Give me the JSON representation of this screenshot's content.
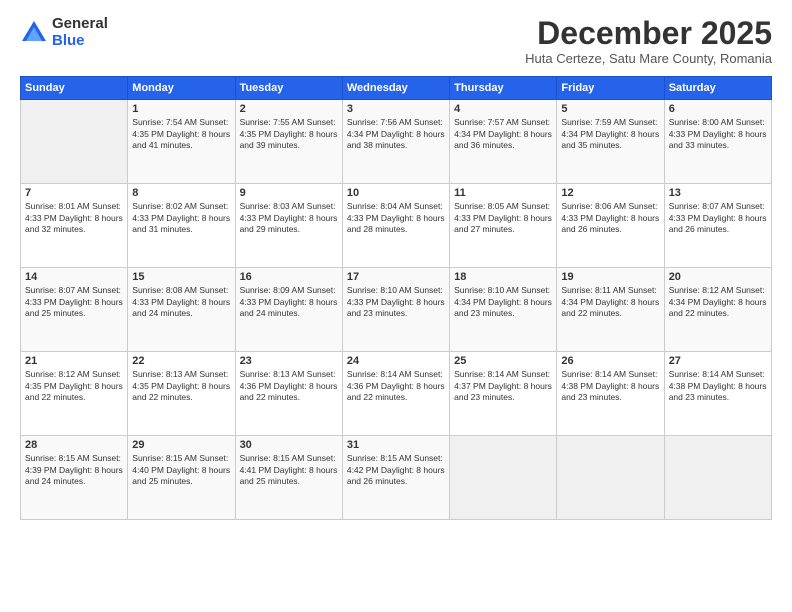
{
  "logo": {
    "general": "General",
    "blue": "Blue"
  },
  "title": "December 2025",
  "location": "Huta Certeze, Satu Mare County, Romania",
  "days_header": [
    "Sunday",
    "Monday",
    "Tuesday",
    "Wednesday",
    "Thursday",
    "Friday",
    "Saturday"
  ],
  "weeks": [
    [
      {
        "day": "",
        "content": ""
      },
      {
        "day": "1",
        "content": "Sunrise: 7:54 AM\nSunset: 4:35 PM\nDaylight: 8 hours\nand 41 minutes."
      },
      {
        "day": "2",
        "content": "Sunrise: 7:55 AM\nSunset: 4:35 PM\nDaylight: 8 hours\nand 39 minutes."
      },
      {
        "day": "3",
        "content": "Sunrise: 7:56 AM\nSunset: 4:34 PM\nDaylight: 8 hours\nand 38 minutes."
      },
      {
        "day": "4",
        "content": "Sunrise: 7:57 AM\nSunset: 4:34 PM\nDaylight: 8 hours\nand 36 minutes."
      },
      {
        "day": "5",
        "content": "Sunrise: 7:59 AM\nSunset: 4:34 PM\nDaylight: 8 hours\nand 35 minutes."
      },
      {
        "day": "6",
        "content": "Sunrise: 8:00 AM\nSunset: 4:33 PM\nDaylight: 8 hours\nand 33 minutes."
      }
    ],
    [
      {
        "day": "7",
        "content": "Sunrise: 8:01 AM\nSunset: 4:33 PM\nDaylight: 8 hours\nand 32 minutes."
      },
      {
        "day": "8",
        "content": "Sunrise: 8:02 AM\nSunset: 4:33 PM\nDaylight: 8 hours\nand 31 minutes."
      },
      {
        "day": "9",
        "content": "Sunrise: 8:03 AM\nSunset: 4:33 PM\nDaylight: 8 hours\nand 29 minutes."
      },
      {
        "day": "10",
        "content": "Sunrise: 8:04 AM\nSunset: 4:33 PM\nDaylight: 8 hours\nand 28 minutes."
      },
      {
        "day": "11",
        "content": "Sunrise: 8:05 AM\nSunset: 4:33 PM\nDaylight: 8 hours\nand 27 minutes."
      },
      {
        "day": "12",
        "content": "Sunrise: 8:06 AM\nSunset: 4:33 PM\nDaylight: 8 hours\nand 26 minutes."
      },
      {
        "day": "13",
        "content": "Sunrise: 8:07 AM\nSunset: 4:33 PM\nDaylight: 8 hours\nand 26 minutes."
      }
    ],
    [
      {
        "day": "14",
        "content": "Sunrise: 8:07 AM\nSunset: 4:33 PM\nDaylight: 8 hours\nand 25 minutes."
      },
      {
        "day": "15",
        "content": "Sunrise: 8:08 AM\nSunset: 4:33 PM\nDaylight: 8 hours\nand 24 minutes."
      },
      {
        "day": "16",
        "content": "Sunrise: 8:09 AM\nSunset: 4:33 PM\nDaylight: 8 hours\nand 24 minutes."
      },
      {
        "day": "17",
        "content": "Sunrise: 8:10 AM\nSunset: 4:33 PM\nDaylight: 8 hours\nand 23 minutes."
      },
      {
        "day": "18",
        "content": "Sunrise: 8:10 AM\nSunset: 4:34 PM\nDaylight: 8 hours\nand 23 minutes."
      },
      {
        "day": "19",
        "content": "Sunrise: 8:11 AM\nSunset: 4:34 PM\nDaylight: 8 hours\nand 22 minutes."
      },
      {
        "day": "20",
        "content": "Sunrise: 8:12 AM\nSunset: 4:34 PM\nDaylight: 8 hours\nand 22 minutes."
      }
    ],
    [
      {
        "day": "21",
        "content": "Sunrise: 8:12 AM\nSunset: 4:35 PM\nDaylight: 8 hours\nand 22 minutes."
      },
      {
        "day": "22",
        "content": "Sunrise: 8:13 AM\nSunset: 4:35 PM\nDaylight: 8 hours\nand 22 minutes."
      },
      {
        "day": "23",
        "content": "Sunrise: 8:13 AM\nSunset: 4:36 PM\nDaylight: 8 hours\nand 22 minutes."
      },
      {
        "day": "24",
        "content": "Sunrise: 8:14 AM\nSunset: 4:36 PM\nDaylight: 8 hours\nand 22 minutes."
      },
      {
        "day": "25",
        "content": "Sunrise: 8:14 AM\nSunset: 4:37 PM\nDaylight: 8 hours\nand 23 minutes."
      },
      {
        "day": "26",
        "content": "Sunrise: 8:14 AM\nSunset: 4:38 PM\nDaylight: 8 hours\nand 23 minutes."
      },
      {
        "day": "27",
        "content": "Sunrise: 8:14 AM\nSunset: 4:38 PM\nDaylight: 8 hours\nand 23 minutes."
      }
    ],
    [
      {
        "day": "28",
        "content": "Sunrise: 8:15 AM\nSunset: 4:39 PM\nDaylight: 8 hours\nand 24 minutes."
      },
      {
        "day": "29",
        "content": "Sunrise: 8:15 AM\nSunset: 4:40 PM\nDaylight: 8 hours\nand 25 minutes."
      },
      {
        "day": "30",
        "content": "Sunrise: 8:15 AM\nSunset: 4:41 PM\nDaylight: 8 hours\nand 25 minutes."
      },
      {
        "day": "31",
        "content": "Sunrise: 8:15 AM\nSunset: 4:42 PM\nDaylight: 8 hours\nand 26 minutes."
      },
      {
        "day": "",
        "content": ""
      },
      {
        "day": "",
        "content": ""
      },
      {
        "day": "",
        "content": ""
      }
    ]
  ]
}
